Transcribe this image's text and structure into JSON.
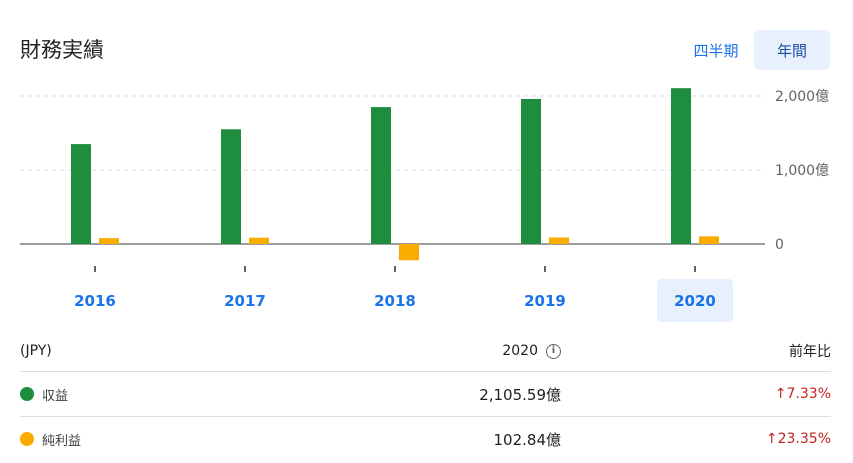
{
  "header": {
    "title": "財務実績",
    "tab_quarterly": "四半期",
    "tab_annual": "年間"
  },
  "colors": {
    "revenue": "#1e8e3e",
    "net_income": "#f9ab00",
    "selected_bg": "#e8f0fe",
    "link": "#1a73e8",
    "negative": "#c5221f"
  },
  "chart_data": {
    "type": "bar",
    "categories": [
      "2016",
      "2017",
      "2018",
      "2019",
      "2020"
    ],
    "selected_category": "2020",
    "series": [
      {
        "name": "収益",
        "values": [
          1350,
          1550,
          1850,
          1960,
          2105.59
        ]
      },
      {
        "name": "純利益",
        "values": [
          80,
          85,
          -220,
          88,
          102.84
        ]
      }
    ],
    "yticks": [
      {
        "value": 2000,
        "label": "2,000億"
      },
      {
        "value": 1000,
        "label": "1,000億"
      },
      {
        "value": 0,
        "label": "0"
      }
    ],
    "ylim": [
      -220,
      2150
    ],
    "grid": true,
    "axis_position": "right"
  },
  "table": {
    "header": {
      "label": "(JPY)",
      "year": "2020",
      "yoy": "前年比"
    },
    "rows": [
      {
        "name": "収益",
        "value": "2,105.59億",
        "change": "7.33%",
        "arrow": "↑"
      },
      {
        "name": "純利益",
        "value": "102.84億",
        "change": "23.35%",
        "arrow": "↑"
      }
    ]
  }
}
